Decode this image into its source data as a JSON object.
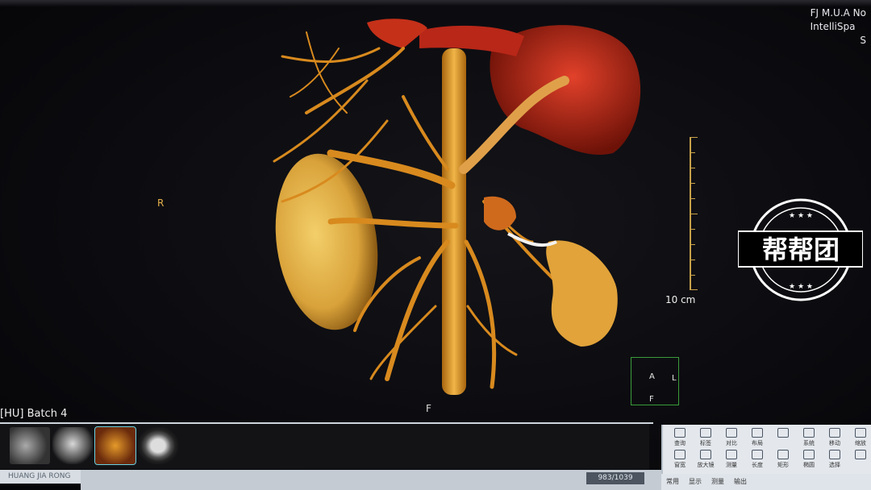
{
  "header": {
    "vendor_line1": "FJ M.U.A No",
    "vendor_line2": "IntelliSpa",
    "vendor_line3": "S"
  },
  "viewport": {
    "orientation_right": "R",
    "orientation_feet": "F",
    "scale_label": "10 cm",
    "cube_labels": {
      "anterior": "A",
      "left": "L",
      "feet": "F"
    }
  },
  "series_bar": {
    "label": "[HU] Batch 4"
  },
  "patient_name": "HUANG JIA RONG",
  "counter": "983/1039",
  "tools": [
    {
      "label": "查询",
      "icon": "query-icon"
    },
    {
      "label": "标签",
      "icon": "tag-icon"
    },
    {
      "label": "对比",
      "icon": "compare-icon"
    },
    {
      "label": "布局",
      "icon": "layout-icon"
    },
    {
      "label": "",
      "icon": "blank-icon"
    },
    {
      "label": "系统",
      "icon": "system-icon"
    },
    {
      "label": "移动",
      "icon": "move-icon"
    },
    {
      "label": "缩放",
      "icon": "zoom-icon"
    },
    {
      "label": "窗宽",
      "icon": "window-icon"
    },
    {
      "label": "放大镜",
      "icon": "magnifier-icon"
    },
    {
      "label": "测量",
      "icon": "measure-icon"
    },
    {
      "label": "长度",
      "icon": "length-icon"
    },
    {
      "label": "矩形",
      "icon": "rectangle-icon"
    },
    {
      "label": "椭圆",
      "icon": "ellipse-icon"
    },
    {
      "label": "选择",
      "icon": "select-icon"
    },
    {
      "label": "",
      "icon": "blank-icon"
    }
  ],
  "tabs": [
    "常用",
    "显示",
    "测量",
    "输出"
  ],
  "watermark": "帮帮团",
  "colors": {
    "vessel": "#d78a1c",
    "liver": "#b5221a",
    "kidney": "#e2b24a",
    "background": "#0b0b0f",
    "accent_green": "#3a9b3a"
  }
}
